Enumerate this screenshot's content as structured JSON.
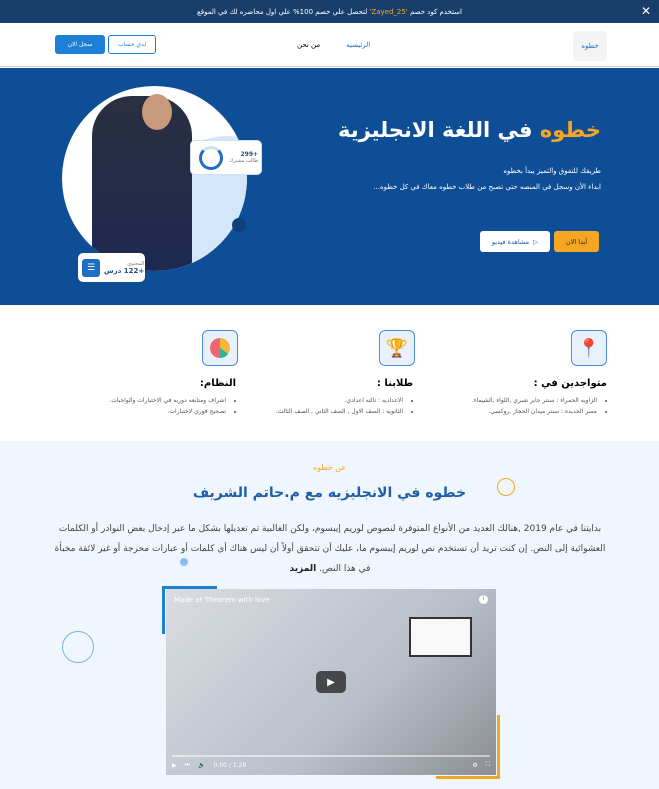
{
  "promo": {
    "before": "استخدم كود خصم ",
    "code": "'Zayed_25'",
    "after": " لتحصل علي خصم 100% علي اول محاضره لك في الموقع"
  },
  "nav": {
    "logo": "خطوه",
    "home": "الرئيسيه",
    "about": "من نحن",
    "account": "لدي حساب",
    "register": "سجل الان"
  },
  "hero": {
    "title_accent": "خطوه",
    "title_rest": " في اللغة الانجليزية",
    "line1": "طريقك للتفوق والتميز يبدأ بخطوه",
    "line2": "ابداء الأن وسجل في المنصه حتي تصبح من طلاب خطوه معاك في كل خطوه...",
    "start": "أبدا الان",
    "video": "مشاهدة فيديو",
    "students_count": "+299",
    "students_label": "طالب مشترك",
    "content_label": "المحتوي",
    "content_value": "+122 درس"
  },
  "features": [
    {
      "title": "متواجدين في :",
      "items": [
        "الزاويه الحمراء : سنتر جابر شبري ,اللواء ,الشيماء.",
        "مصر الجديده : سنتر ميدان الحجاز ,روكسي."
      ]
    },
    {
      "title": "طلابنا :",
      "items": [
        "الاعداديه : تالته اعدادي.",
        "الثانويه : الصف الاول , الصف الثاني , الصف الثالث."
      ]
    },
    {
      "title": "النظام:",
      "items": [
        "اشراف ومتابعه دوريه في الاختبارات والواجبات.",
        "تصحيح فوري لاختبارات."
      ]
    }
  ],
  "about": {
    "tag": "عن خطوه",
    "title": "خطوه في الانجليزيه مع م.حاتم الشريف",
    "body": "بدايتنا في عام 2019 ,هنالك العديد من الأنواع المتوفرة لنصوص لوريم إيبسوم، ولكن الغالبية تم تعديلها بشكل ما عبر إدخال بعض النوادر أو الكلمات العشوائية إلى النص. إن كنت تريد أن تستخدم نص لوريم إيبسوم ما، عليك أن تتحقق أولاً أن ليس هناك أي كلمات أو عبارات محرجة أو غير لائقة مخبأة في هذا النص.",
    "more": "المزيد"
  },
  "video": {
    "title": "Made at Theorem with love",
    "time": "0:00 / 1:28"
  },
  "colors": {
    "primary": "#0e4e96",
    "accent": "#f5a623"
  }
}
